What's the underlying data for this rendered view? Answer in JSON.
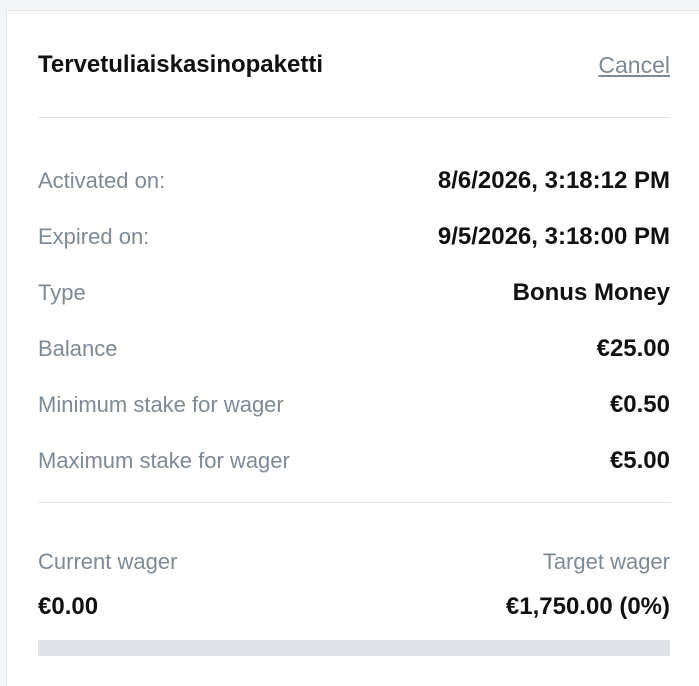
{
  "header": {
    "title": "Tervetuliaiskasinopaketti",
    "cancel_label": "Cancel"
  },
  "details": [
    {
      "label": "Activated on:",
      "value": "8/6/2026, 3:18:12 PM"
    },
    {
      "label": "Expired on:",
      "value": "9/5/2026, 3:18:00 PM"
    },
    {
      "label": "Type",
      "value": "Bonus Money"
    },
    {
      "label": "Balance",
      "value": "€25.00"
    },
    {
      "label": "Minimum stake for wager",
      "value": "€0.50"
    },
    {
      "label": "Maximum stake for wager",
      "value": "€5.00"
    }
  ],
  "wager": {
    "current_label": "Current wager",
    "target_label": "Target wager",
    "current_value": "€0.00",
    "target_value": "€1,750.00 (0%)",
    "progress_percent": 0
  },
  "colors": {
    "label": "#7d8a96",
    "value": "#111111",
    "progress_track": "#dfe2e6"
  }
}
